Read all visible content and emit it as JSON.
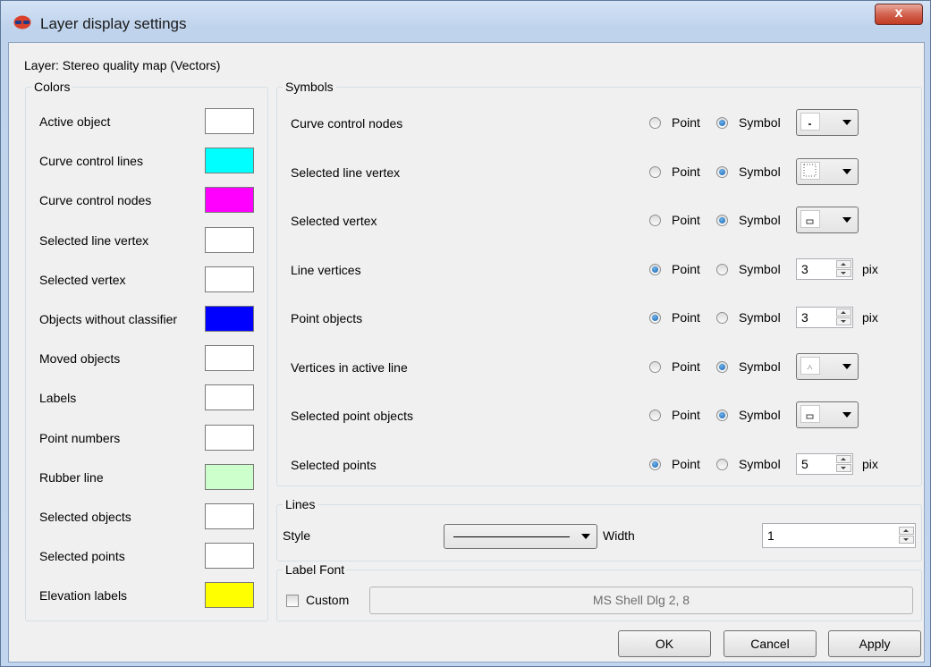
{
  "window": {
    "title": "Layer display settings",
    "close_label": "x"
  },
  "layer_label": "Layer: Stereo quality map (Vectors)",
  "colors": {
    "title": "Colors",
    "items": [
      {
        "label": "Active object",
        "color": "#ffffff"
      },
      {
        "label": "Curve control lines",
        "color": "#00ffff"
      },
      {
        "label": "Curve control nodes",
        "color": "#ff00ff"
      },
      {
        "label": "Selected line vertex",
        "color": "#ffffff"
      },
      {
        "label": "Selected vertex",
        "color": "#ffffff"
      },
      {
        "label": "Objects without classifier",
        "color": "#0000ff"
      },
      {
        "label": "Moved objects",
        "color": "#ffffff"
      },
      {
        "label": "Labels",
        "color": "#ffffff"
      },
      {
        "label": "Point numbers",
        "color": "#ffffff"
      },
      {
        "label": "Rubber line",
        "color": "#ccffcc"
      },
      {
        "label": "Selected objects",
        "color": "#ffffff"
      },
      {
        "label": "Selected points",
        "color": "#ffffff"
      },
      {
        "label": "Elevation labels",
        "color": "#ffff00"
      }
    ]
  },
  "symbols": {
    "title": "Symbols",
    "point_label": "Point",
    "symbol_label": "Symbol",
    "unit": "pix",
    "items": [
      {
        "label": "Curve control nodes",
        "mode": "symbol",
        "icon": "dot-symbol-icon"
      },
      {
        "label": "Selected line vertex",
        "mode": "symbol",
        "icon": "dotted-square-symbol-icon"
      },
      {
        "label": "Selected vertex",
        "mode": "symbol",
        "icon": "small-square-symbol-icon"
      },
      {
        "label": "Line vertices",
        "mode": "point",
        "size": "3"
      },
      {
        "label": "Point objects",
        "mode": "point",
        "size": "3"
      },
      {
        "label": "Vertices in active line",
        "mode": "symbol",
        "icon": "triangle-symbol-icon"
      },
      {
        "label": "Selected point objects",
        "mode": "symbol",
        "icon": "small-square-symbol-icon"
      },
      {
        "label": "Selected points",
        "mode": "point",
        "size": "5"
      }
    ]
  },
  "lines": {
    "title": "Lines",
    "style_label": "Style",
    "width_label": "Width",
    "width_value": "1"
  },
  "label_font": {
    "title": "Label Font",
    "custom_label": "Custom",
    "custom_checked": false,
    "font_value": "MS Shell Dlg 2, 8"
  },
  "buttons": {
    "ok": "OK",
    "cancel": "Cancel",
    "apply": "Apply"
  }
}
